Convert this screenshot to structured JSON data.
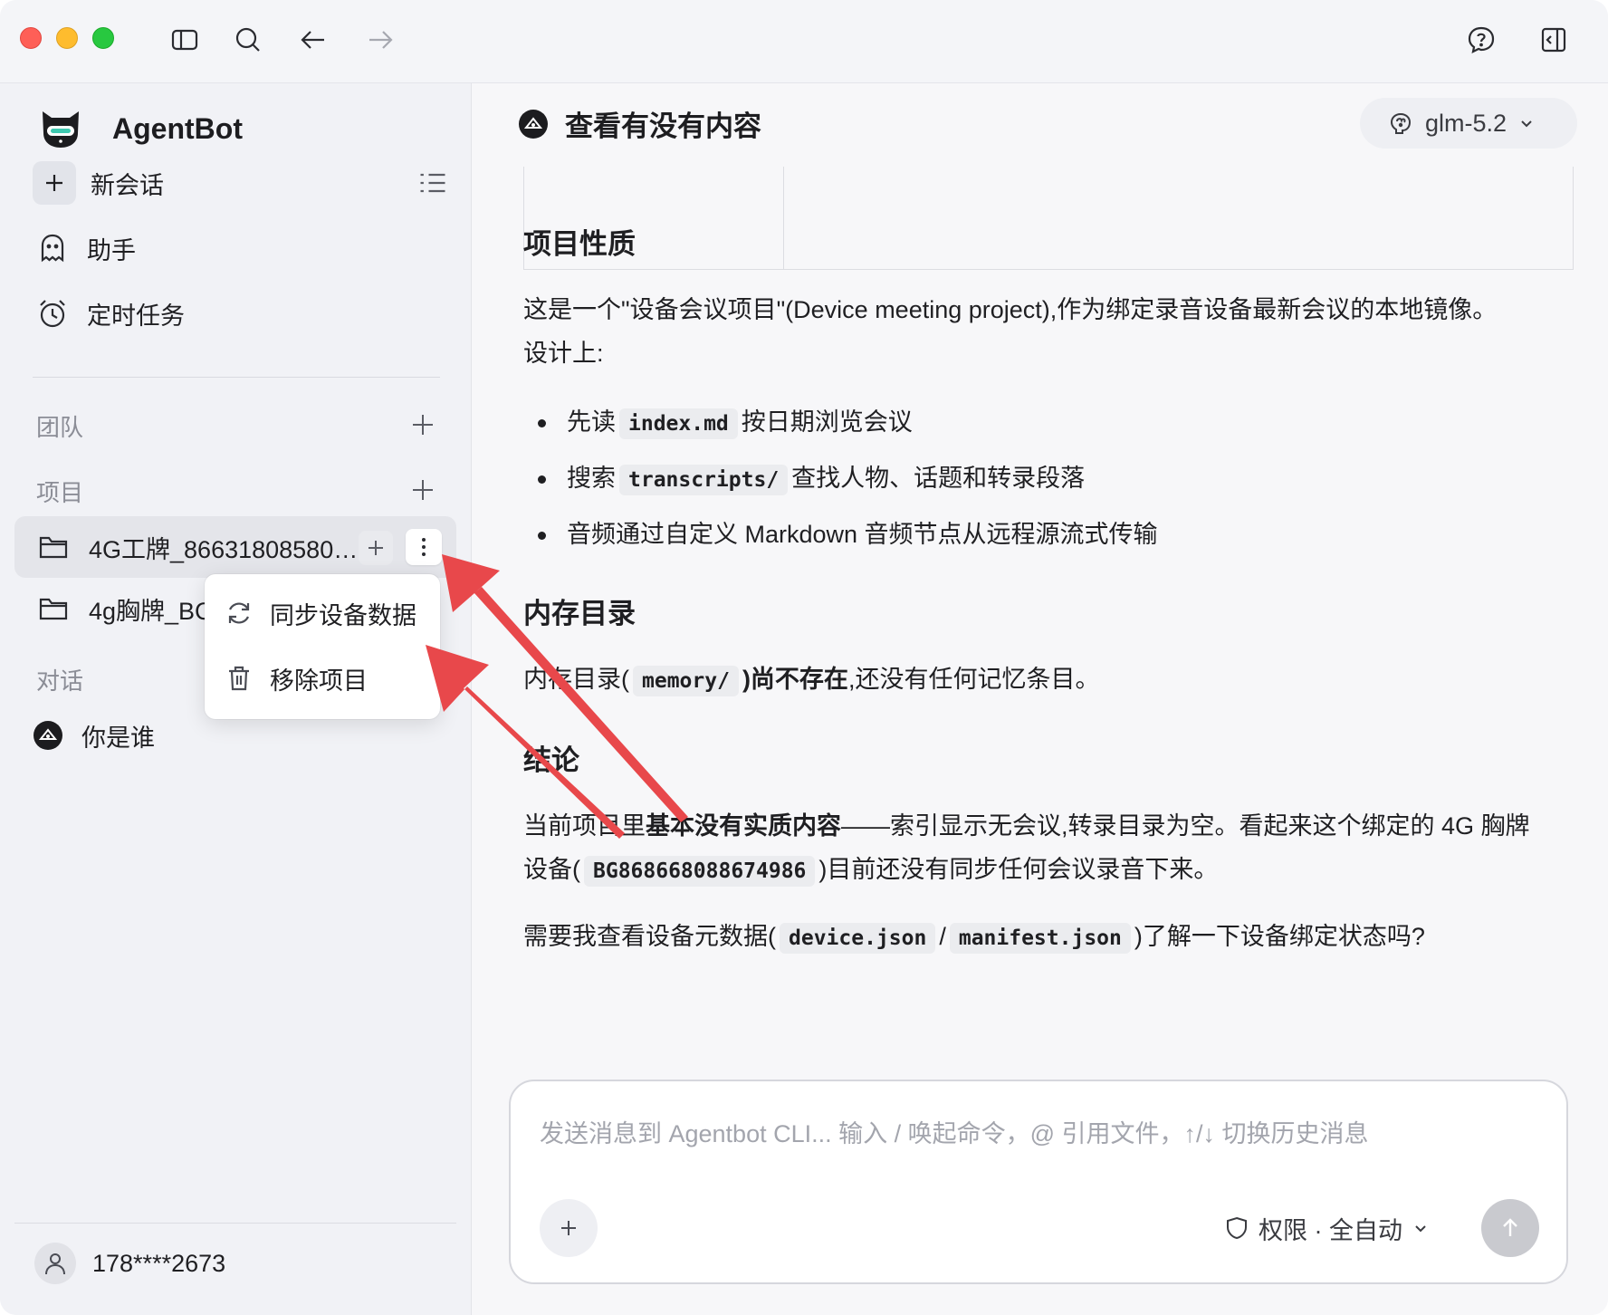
{
  "app": {
    "name": "AgentBot"
  },
  "sidebar": {
    "new_chat_label": "新会话",
    "nav": [
      {
        "label": "助手",
        "icon": "ghost-icon"
      },
      {
        "label": "定时任务",
        "icon": "alarm-clock-icon"
      }
    ],
    "sections": {
      "team": "团队",
      "projects": "项目",
      "conversations": "对话"
    },
    "projects": [
      {
        "label": "4G工牌_86631808580…",
        "active": true
      },
      {
        "label": "4g胸牌_BC"
      }
    ],
    "conversations": [
      {
        "label": "你是谁"
      }
    ],
    "user": {
      "name": "178****2673"
    }
  },
  "context_menu": {
    "items": [
      {
        "label": "同步设备数据",
        "icon": "sync-icon"
      },
      {
        "label": "移除项目",
        "icon": "trash-icon"
      }
    ]
  },
  "header": {
    "chat_title": "查看有没有内容",
    "model": "glm-5.2"
  },
  "message": {
    "section1_title": "项目性质",
    "section1_p1": "这是一个\"设备会议项目\"(Device meeting project),作为绑定录音设备最新会议的本地镜像。",
    "section1_p2": "设计上:",
    "bullets": [
      {
        "pre": "先读",
        "code": "index.md",
        "post": "按日期浏览会议"
      },
      {
        "pre": "搜索",
        "code": "transcripts/",
        "post": "查找人物、话题和转录段落"
      },
      {
        "pre": "音频通过自定义 Markdown 音频节点从远程源流式传输",
        "code": "",
        "post": ""
      }
    ],
    "section2_title": "内存目录",
    "section2_pre": "内存目录(",
    "section2_code": "memory/",
    "section2_bold": ")尚不存在",
    "section2_post": ",还没有任何记忆条目。",
    "section3_title": "结论",
    "section3_l1_pre": "当前项目里",
    "section3_l1_bold": "基本没有实质内容",
    "section3_l1_post": "——索引显示无会议,转录目录为空。看起来这个绑定的 4G 胸牌",
    "section3_l2_pre": "设备(",
    "section3_l2_code": "BG868668088674986",
    "section3_l2_post": ")目前还没有同步任何会议录音下来。",
    "question_pre": "需要我查看设备元数据(",
    "question_code1": "device.json",
    "question_sep": "/",
    "question_code2": "manifest.json",
    "question_post": ")了解一下设备绑定状态吗?"
  },
  "composer": {
    "placeholder": "发送消息到 Agentbot CLI...  输入 / 唤起命令，@ 引用文件，↑/↓ 切换历史消息",
    "permission_label": "权限 · 全自动"
  },
  "annotation": {
    "arrow_color": "#e8484b"
  }
}
